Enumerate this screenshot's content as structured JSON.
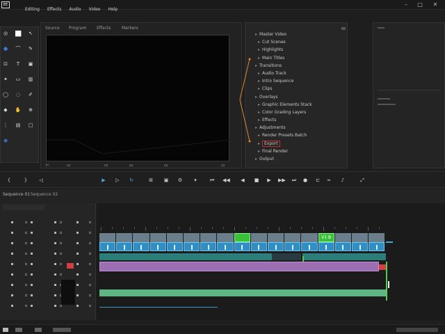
{
  "app": {
    "logo": "EE",
    "menu": [
      "Editing",
      "Effects",
      "Audio",
      "Video",
      "Help"
    ]
  },
  "window_controls": [
    "–",
    "□",
    "✕"
  ],
  "tools": [
    "selection-icon",
    "color-swatch-icon",
    "arrow-icon",
    "color-picker-icon",
    "lasso-icon",
    "pen-icon",
    "crop-icon",
    "type-icon",
    "paint-icon",
    "effect-icon",
    "rect-icon",
    "gradient-icon",
    "ellipse-icon",
    "blur-icon",
    "brush-icon",
    "shape-icon",
    "hand-icon",
    "zoom-icon",
    "grid-icon",
    "layer-icon",
    "square-icon",
    "globe-icon"
  ],
  "monitor_tabs": [
    "Source",
    "Program",
    "Effects",
    "Markers"
  ],
  "tree": {
    "rows": [
      "Master Video",
      "Cut Scenes",
      "Highlights",
      "Main Titles",
      "Transitions",
      "Audio Track",
      "Intro Sequence",
      "Clips",
      "Overlays",
      "Graphic Elements Stack",
      "Color Grading Layers",
      "Effects",
      "Adjustments",
      "Render Presets Batch",
      "Export",
      "Final Render",
      "Output"
    ],
    "selected_index": 14
  },
  "transport_icons": [
    "mark-in-icon",
    "mark-out-icon",
    "step-back-icon",
    "play-icon",
    "step-forward-icon",
    "loop-icon",
    "safe-margins-icon",
    "export-frame-icon",
    "settings-icon",
    "marker-icon",
    "go-start-icon",
    "rewind-icon",
    "play-back-icon",
    "stop-icon",
    "play-fwd-icon",
    "fast-fwd-icon",
    "go-end-icon",
    "record-icon",
    "snap-icon",
    "link-icon",
    "volume-icon",
    "fullscreen-icon"
  ],
  "timeline": {
    "tabs": [
      "Sequence 01",
      "Sequence 02"
    ],
    "green_clip_label": "V1 B",
    "clips": [
      {
        "type": "thumb"
      },
      {
        "type": "thumb"
      },
      {
        "type": "blue"
      },
      {
        "type": "thumb"
      },
      {
        "type": "blue"
      },
      {
        "type": "thumb"
      },
      {
        "type": "blue"
      },
      {
        "type": "thumb"
      },
      {
        "type": "green"
      },
      {
        "type": "thumb"
      },
      {
        "type": "blue"
      },
      {
        "type": "thumb"
      },
      {
        "type": "blue"
      },
      {
        "type": "green"
      },
      {
        "type": "thumb"
      },
      {
        "type": "blue"
      },
      {
        "type": "thumb"
      }
    ]
  },
  "colors": {
    "accent_blue": "#2f8fc4",
    "accent_green": "#3ac13a",
    "audio_purple": "#9c6fb3",
    "audio_green": "#5fb583",
    "teal": "#2d7d7a"
  }
}
